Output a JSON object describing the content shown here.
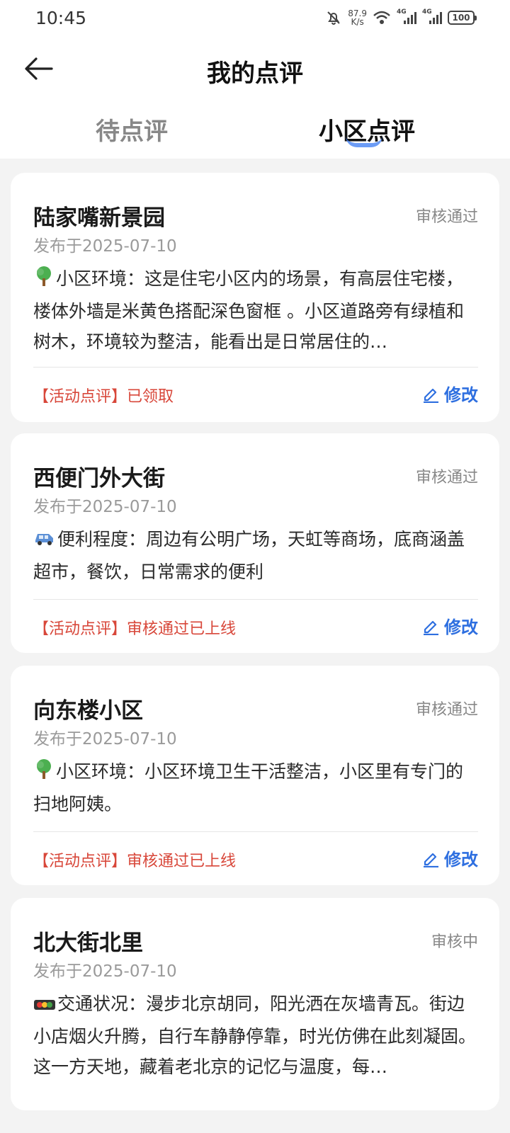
{
  "status_bar": {
    "time": "10:45",
    "net_speed_value": "87.9",
    "net_speed_unit": "K/s",
    "signal_label_1": "4G",
    "signal_label_2": "4G",
    "battery": "100"
  },
  "header": {
    "title": "我的点评"
  },
  "tabs": [
    {
      "label": "待点评",
      "active": false
    },
    {
      "label": "小区点评",
      "active": true
    }
  ],
  "colors": {
    "accent": "#3c7cf2",
    "activity_red": "#d8473a",
    "link_blue": "#2e6fe0"
  },
  "reviews": [
    {
      "name": "陆家嘴新景园",
      "status": "审核通过",
      "date": "发布于2025-07-10",
      "icon": "tree-icon",
      "content": "小区环境：这是住宅小区内的场景，有高层住宅楼，楼体外墙是米黄色搭配深色窗框 。小区道路旁有绿植和树木，环境较为整洁，能看出是日常居住的…",
      "activity": "【活动点评】已领取",
      "edit_label": "修改"
    },
    {
      "name": "西便门外大街",
      "status": "审核通过",
      "date": "发布于2025-07-10",
      "icon": "car-icon",
      "content": "便利程度：周边有公明广场，天虹等商场，底商涵盖超市，餐饮，日常需求的便利",
      "activity": "【活动点评】审核通过已上线",
      "edit_label": "修改"
    },
    {
      "name": "向东楼小区",
      "status": "审核通过",
      "date": "发布于2025-07-10",
      "icon": "tree-icon",
      "content": "小区环境：小区环境卫生干活整洁，小区里有专门的扫地阿姨。",
      "activity": "【活动点评】审核通过已上线",
      "edit_label": "修改"
    },
    {
      "name": "北大街北里",
      "status": "审核中",
      "date": "发布于2025-07-10",
      "icon": "traffic-light-icon",
      "content": "交通状况：漫步北京胡同，阳光洒在灰墙青瓦。街边小店烟火升腾，自行车静静停靠，时光仿佛在此刻凝固。这一方天地，藏着老北京的记忆与温度，每…"
    }
  ]
}
